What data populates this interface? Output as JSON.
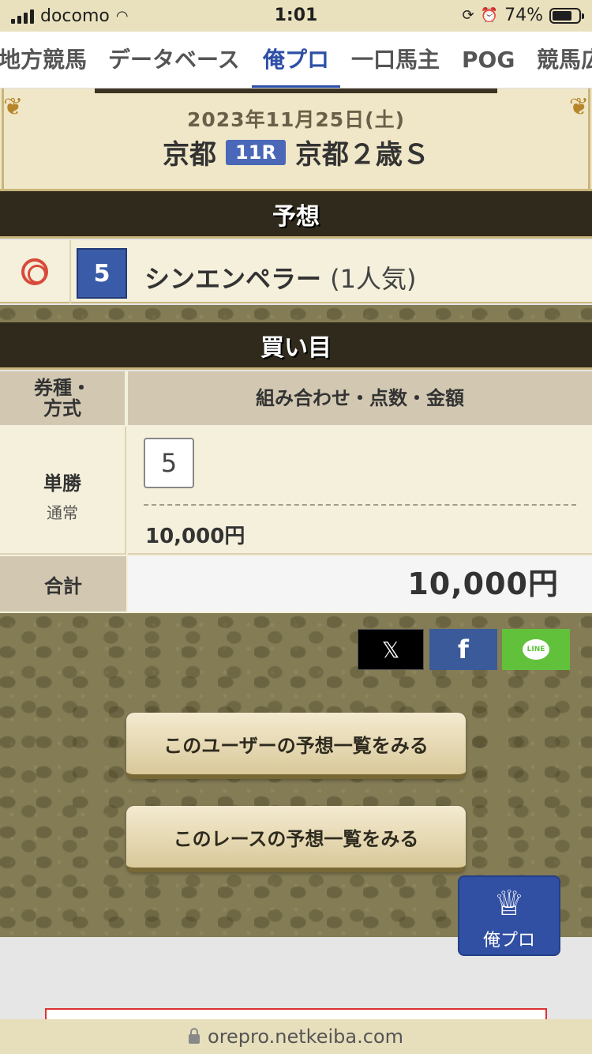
{
  "status_bar": {
    "carrier": "docomo",
    "time": "1:01",
    "battery_percent": "74%",
    "battery_level": 0.74
  },
  "nav": {
    "tabs": [
      {
        "label": "地方競馬"
      },
      {
        "label": "データベース"
      },
      {
        "label": "俺プロ"
      },
      {
        "label": "一口馬主"
      },
      {
        "label": "POG"
      },
      {
        "label": "競馬広"
      }
    ],
    "active_tab": "俺プロ"
  },
  "race": {
    "date": "2023年11月25日(土)",
    "venue": "京都",
    "round": "11R",
    "name": "京都２歳Ｓ"
  },
  "prediction": {
    "section_title": "予想",
    "mark": "◎",
    "horse_number": "5",
    "horse_name": "シンエンペラー",
    "popularity": "(1人気)"
  },
  "bets": {
    "section_title": "買い目",
    "header_type": "券種・方式",
    "header_combo": "組み合わせ・点数・金額",
    "rows": [
      {
        "type": "単勝",
        "method": "通常",
        "selection": "5",
        "amount": "10,000円"
      }
    ],
    "total_label": "合計",
    "total_amount": "10,000円"
  },
  "share": {
    "x_icon": "𝕏",
    "facebook_icon": "f",
    "line_label": "LINE"
  },
  "buttons": {
    "user_predictions": "このユーザーの予想一覧をみる",
    "race_predictions": "このレースの予想一覧をみる"
  },
  "fab": {
    "label": "俺プロ",
    "icon": "trophy-laurel-icon"
  },
  "url": "orepro.netkeiba.com",
  "colors": {
    "accent_blue": "#2e4fa6",
    "dark_bar": "#2f2a1b",
    "mark_red": "#d84a3a",
    "line_green": "#61c13b",
    "facebook_blue": "#3b5a99"
  }
}
